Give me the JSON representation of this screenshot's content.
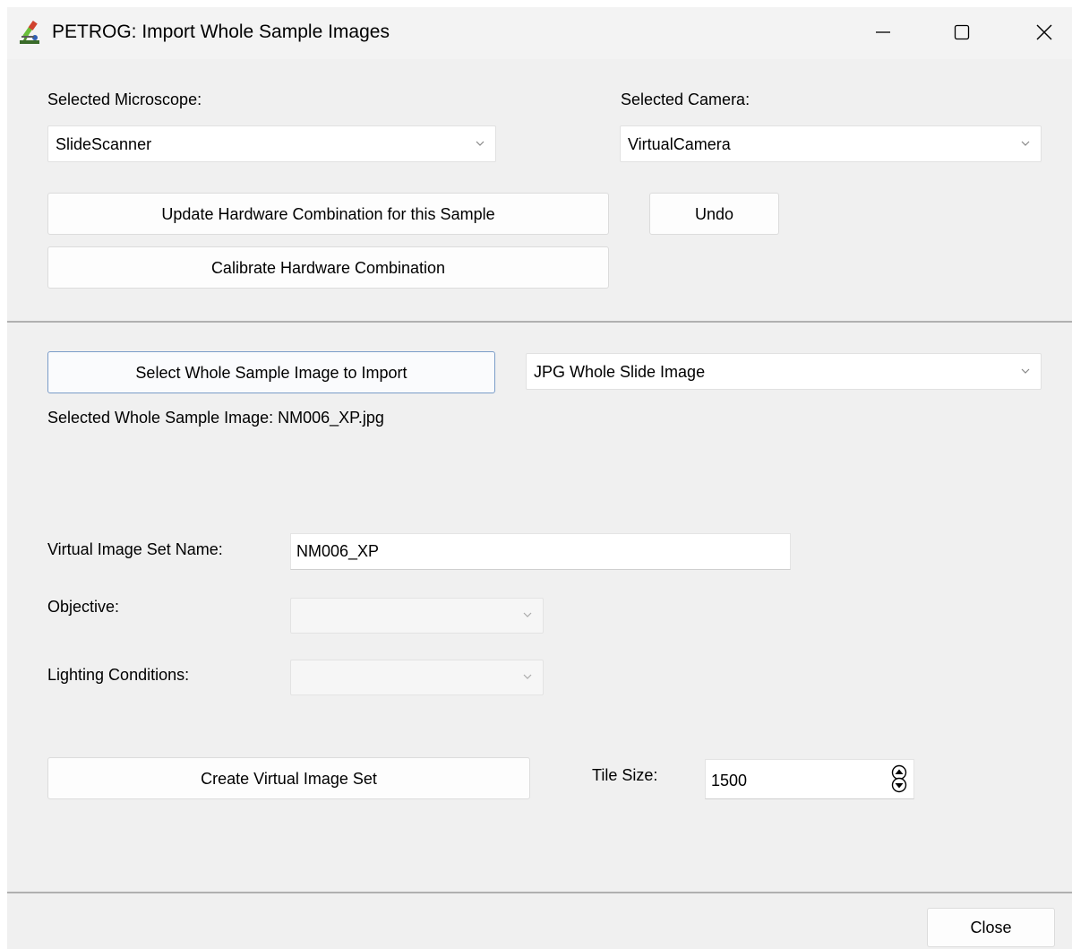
{
  "window": {
    "title": "PETROG: Import Whole Sample Images"
  },
  "hardware": {
    "microscope_label": "Selected Microscope:",
    "microscope_value": "SlideScanner",
    "camera_label": "Selected Camera:",
    "camera_value": "VirtualCamera",
    "update_button": "Update Hardware Combination for this Sample",
    "undo_button": "Undo",
    "calibrate_button": "Calibrate Hardware Combination"
  },
  "import": {
    "select_button": "Select Whole Sample Image to Import",
    "format_value": "JPG Whole Slide Image",
    "selected_text": "Selected Whole Sample Image: NM006_XP.jpg"
  },
  "image_set": {
    "name_label": "Virtual Image Set Name:",
    "name_value": "NM006_XP",
    "objective_label": "Objective:",
    "objective_value": "",
    "lighting_label": "Lighting Conditions:",
    "lighting_value": "",
    "create_button": "Create Virtual Image Set",
    "tile_label": "Tile Size:",
    "tile_value": "1500"
  },
  "footer": {
    "close_button": "Close"
  },
  "icons": {
    "app": "microscope-icon",
    "minimize": "minimize-icon",
    "maximize": "maximize-icon",
    "close": "close-icon",
    "dropdown": "chevron-down-icon",
    "spinner": "spin-arrows-icon"
  }
}
